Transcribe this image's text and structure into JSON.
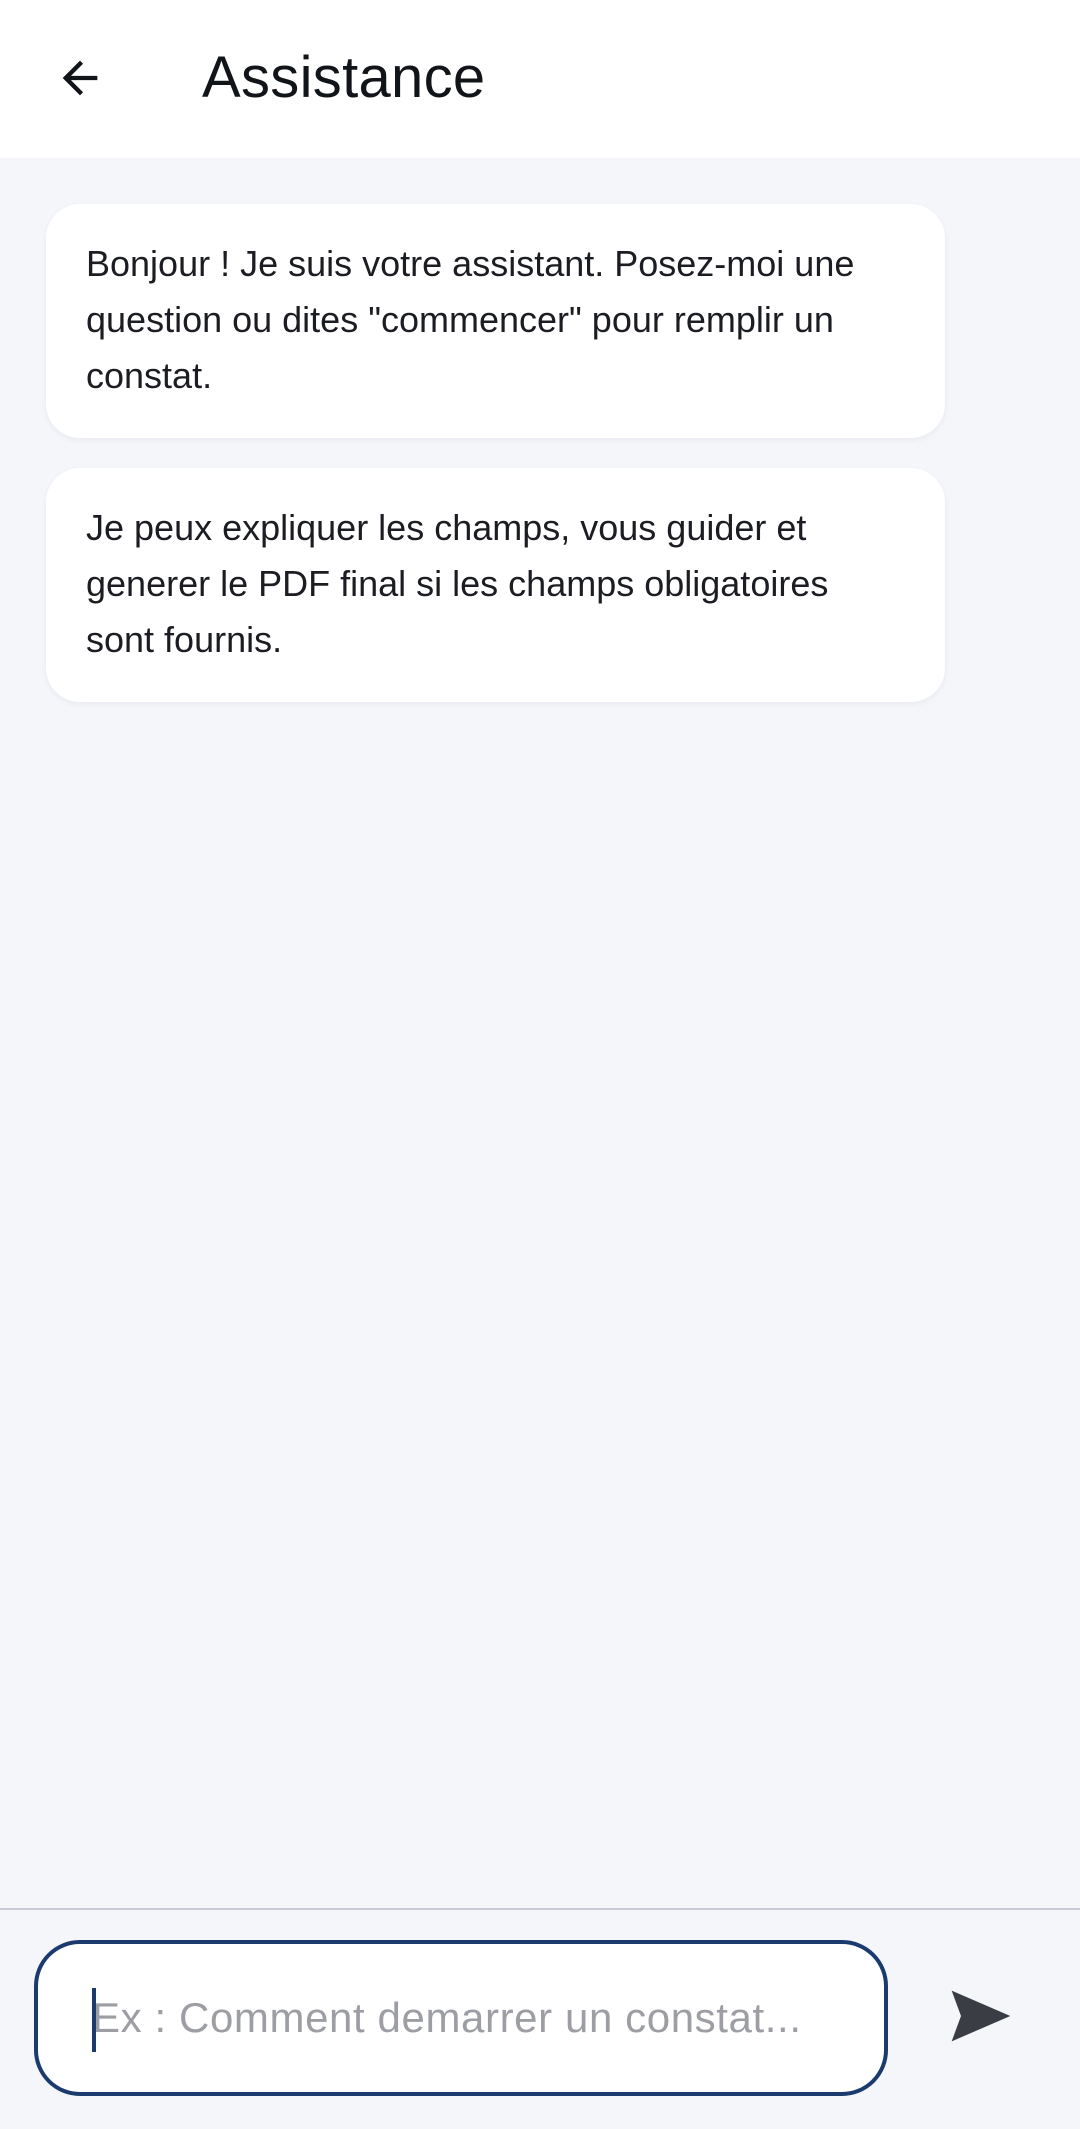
{
  "header": {
    "title": "Assistance",
    "back_icon": "arrow-back-icon"
  },
  "messages": [
    {
      "sender": "assistant",
      "text": "Bonjour ! Je suis votre assistant. Posez-moi une question ou dites \"commencer\" pour remplir un constat."
    },
    {
      "sender": "assistant",
      "text": "Je peux expliquer les champs, vous guider et generer le PDF final si les champs obligatoires sont fournis."
    }
  ],
  "composer": {
    "placeholder": "Ex : Comment demarrer un constat...",
    "value": "",
    "send_icon": "send-icon"
  },
  "colors": {
    "background": "#f4f6fa",
    "surface": "#ffffff",
    "accent": "#1b3a6e",
    "send_icon": "#3a3d44"
  }
}
